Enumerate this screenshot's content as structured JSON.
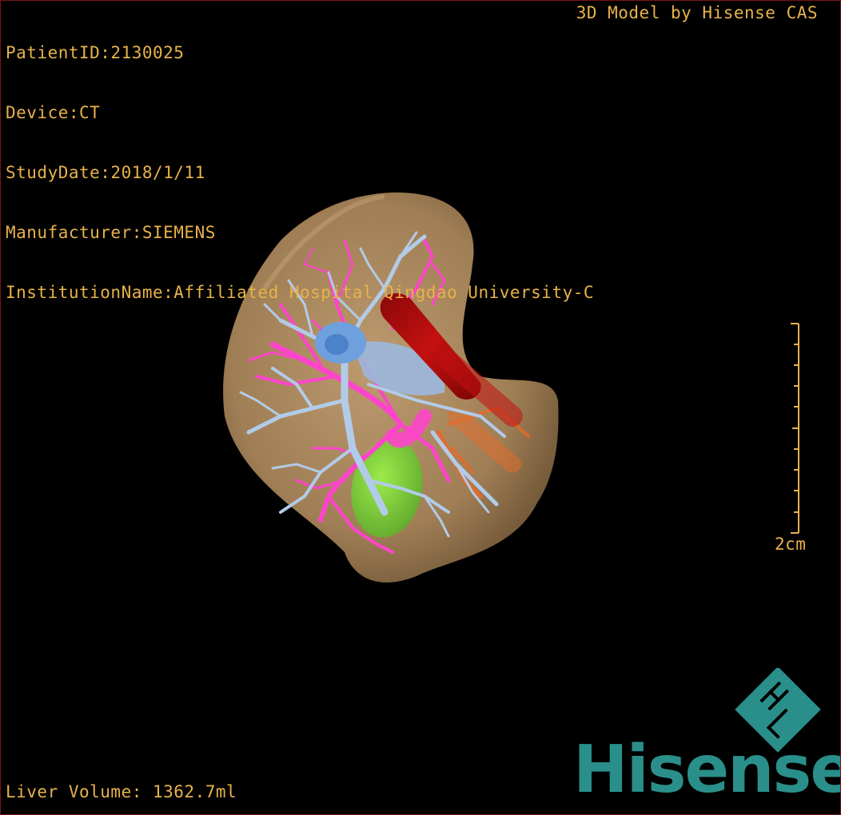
{
  "patient_info": {
    "patient_id": "PatientID:2130025",
    "device": "Device:CT",
    "study_date": "StudyDate:2018/1/11",
    "manufacturer": "Manufacturer:SIEMENS",
    "institution": "InstitutionName:Affiliated Hospital Qingdao University-C"
  },
  "model_title": "3D Model by Hisense CAS",
  "liver_volume": "Liver Volume: 1362.7ml",
  "scale_bar": {
    "label": "2cm"
  },
  "logo": {
    "brand": "Hisense",
    "mark": "HL"
  },
  "colors": {
    "text": "#e8b24a",
    "liver": "#b89466",
    "portal_vein": "#a9c4ea",
    "hepatic_vein": "#ff44cc",
    "inferior_vena_cava": "#c41010",
    "gallbladder": "#7ed63a",
    "artery": "#e66a2a",
    "brand": "#2a8f8a"
  }
}
